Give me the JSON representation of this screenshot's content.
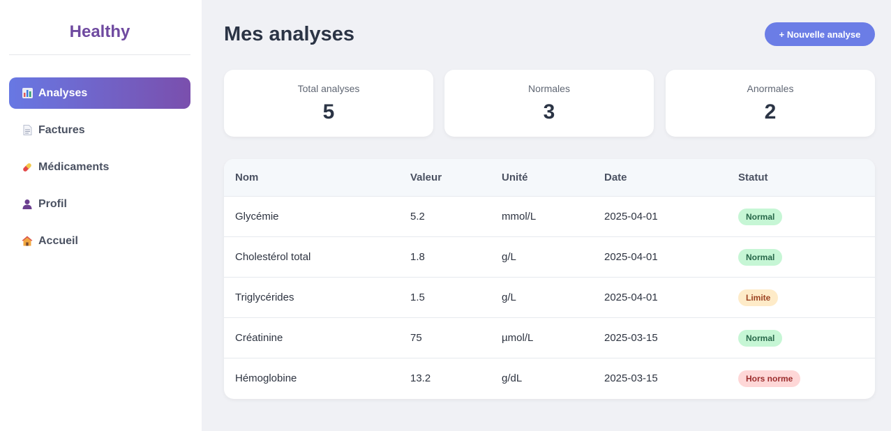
{
  "sidebar": {
    "brand": "Healthy",
    "items": [
      {
        "label": "Analyses",
        "icon": "chart-icon",
        "active": true
      },
      {
        "label": "Factures",
        "icon": "document-icon",
        "active": false
      },
      {
        "label": "Médicaments",
        "icon": "pill-icon",
        "active": false
      },
      {
        "label": "Profil",
        "icon": "user-icon",
        "active": false
      },
      {
        "label": "Accueil",
        "icon": "house-icon",
        "active": false
      }
    ]
  },
  "header": {
    "title": "Mes analyses",
    "new_button_label": "+ Nouvelle analyse"
  },
  "stats": [
    {
      "label": "Total analyses",
      "value": "5"
    },
    {
      "label": "Normales",
      "value": "3"
    },
    {
      "label": "Anormales",
      "value": "2"
    }
  ],
  "table": {
    "columns": [
      "Nom",
      "Valeur",
      "Unité",
      "Date",
      "Statut"
    ],
    "rows": [
      {
        "nom": "Glycémie",
        "valeur": "5.2",
        "unite": "mmol/L",
        "date": "2025-04-01",
        "statut": "Normal"
      },
      {
        "nom": "Cholestérol total",
        "valeur": "1.8",
        "unite": "g/L",
        "date": "2025-04-01",
        "statut": "Normal"
      },
      {
        "nom": "Triglycérides",
        "valeur": "1.5",
        "unite": "g/L",
        "date": "2025-04-01",
        "statut": "Limite"
      },
      {
        "nom": "Créatinine",
        "valeur": "75",
        "unite": "µmol/L",
        "date": "2025-03-15",
        "statut": "Normal"
      },
      {
        "nom": "Hémoglobine",
        "valeur": "13.2",
        "unite": "g/dL",
        "date": "2025-03-15",
        "statut": "Hors norme"
      }
    ]
  },
  "colors": {
    "brand": "#6f4aa0",
    "accent": "#6b7de6",
    "status_normal": "#c6f6d5",
    "status_limite": "#feebc8",
    "status_hors_norme": "#fed7d7"
  }
}
